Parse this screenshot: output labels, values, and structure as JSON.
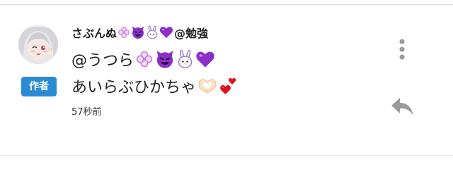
{
  "comment": {
    "username_text": "さぶんぬ",
    "username_suffix": "@勉強",
    "body_line1_text": "@うつら",
    "body_line2_text": "あいらぶひかちゃ",
    "author_badge": "作者",
    "timestamp": "57秒前",
    "icons": {
      "username": [
        "clover-icon",
        "smiling-devil-icon",
        "rabbit-icon",
        "purple-heart-icon"
      ],
      "line1": [
        "clover-icon",
        "smiling-devil-icon",
        "rabbit-icon",
        "purple-heart-icon"
      ],
      "line2": [
        "heart-hands-icon",
        "two-hearts-icon"
      ]
    }
  },
  "actions": {
    "more_icon": "vertical-ellipsis-icon",
    "reply_icon": "reply-arrow-icon"
  },
  "colors": {
    "badge": "#2a8bd5",
    "purple_emoji": "#8b2fc9",
    "clover": "#c77dde",
    "heart_red": "#e0101a",
    "icon_gray": "#9a9a9a",
    "divider": "#e4e4e4"
  }
}
